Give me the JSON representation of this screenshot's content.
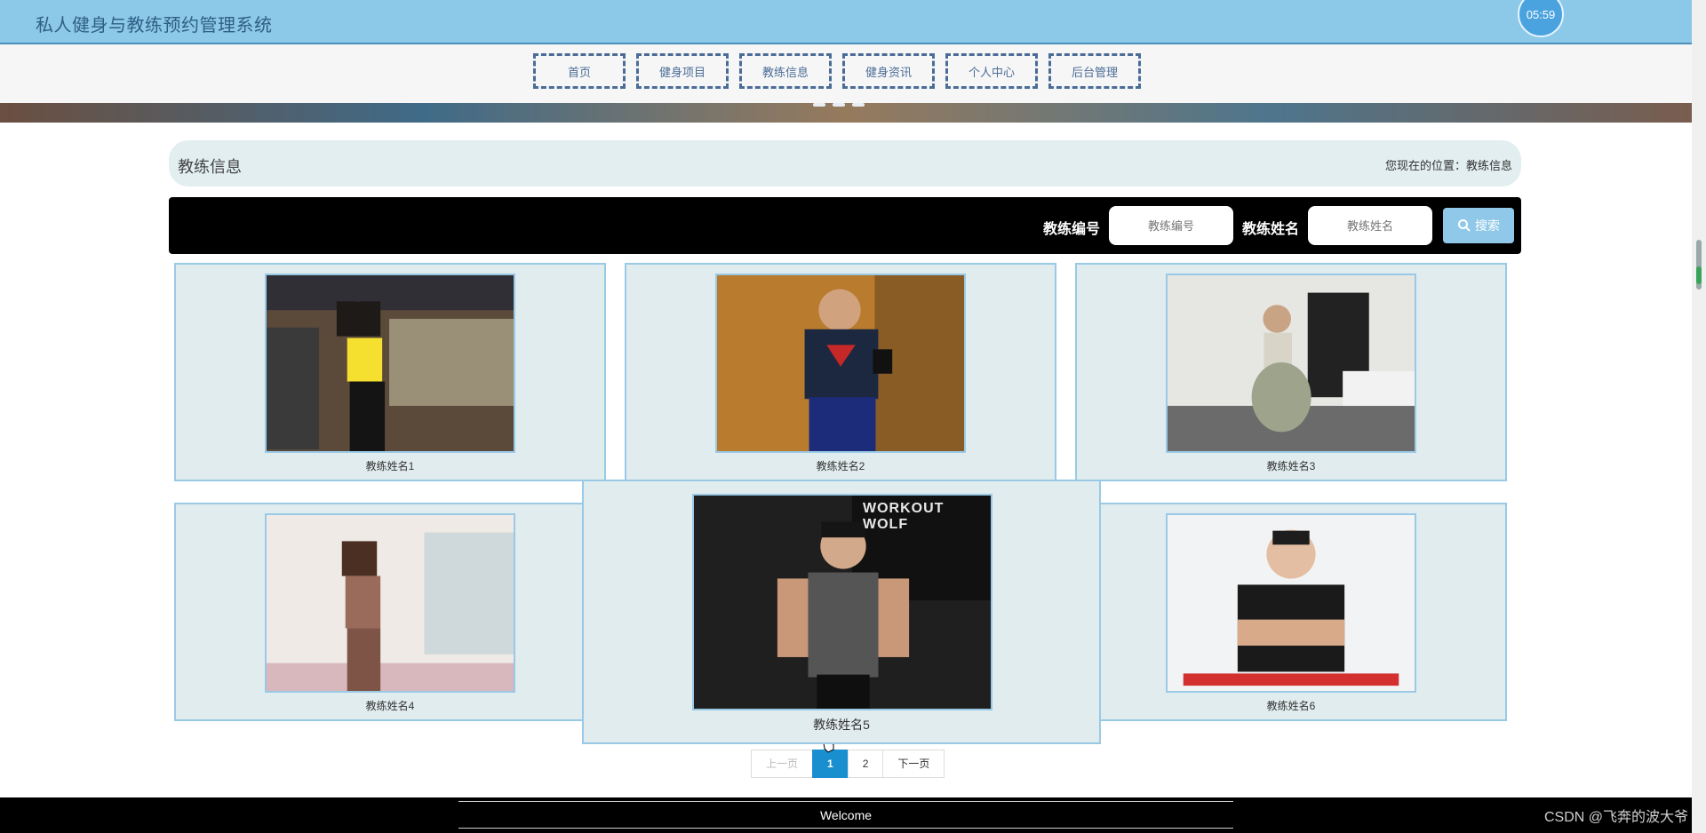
{
  "header": {
    "title": "私人健身与教练预约管理系统",
    "clock": "05:59"
  },
  "nav": [
    "首页",
    "健身项目",
    "教练信息",
    "健身资讯",
    "个人中心",
    "后台管理"
  ],
  "breadcrumb": {
    "title": "教练信息",
    "location": "您现在的位置：教练信息"
  },
  "search": {
    "label_id": "教练编号",
    "placeholder_id": "教练编号",
    "label_name": "教练姓名",
    "placeholder_name": "教练姓名",
    "button": "搜索"
  },
  "coaches": [
    {
      "name": "教练姓名1",
      "photo": "woman-yellow-top-gym"
    },
    {
      "name": "教练姓名2",
      "photo": "man-superman-shirt"
    },
    {
      "name": "教练姓名3",
      "photo": "woman-green-leggings"
    },
    {
      "name": "教练姓名4",
      "photo": "woman-brown-tank"
    },
    {
      "name": "教练姓名5",
      "photo": "man-workout-wolf",
      "banner": "WORKOUT WOLF"
    },
    {
      "name": "教练姓名6",
      "photo": "man-black-tshirt"
    }
  ],
  "pagination": {
    "prev": "上一页",
    "pages": [
      "1",
      "2"
    ],
    "current": "1",
    "next": "下一页"
  },
  "footer": {
    "text": "Welcome"
  },
  "watermark": "CSDN @飞奔的波大爷"
}
